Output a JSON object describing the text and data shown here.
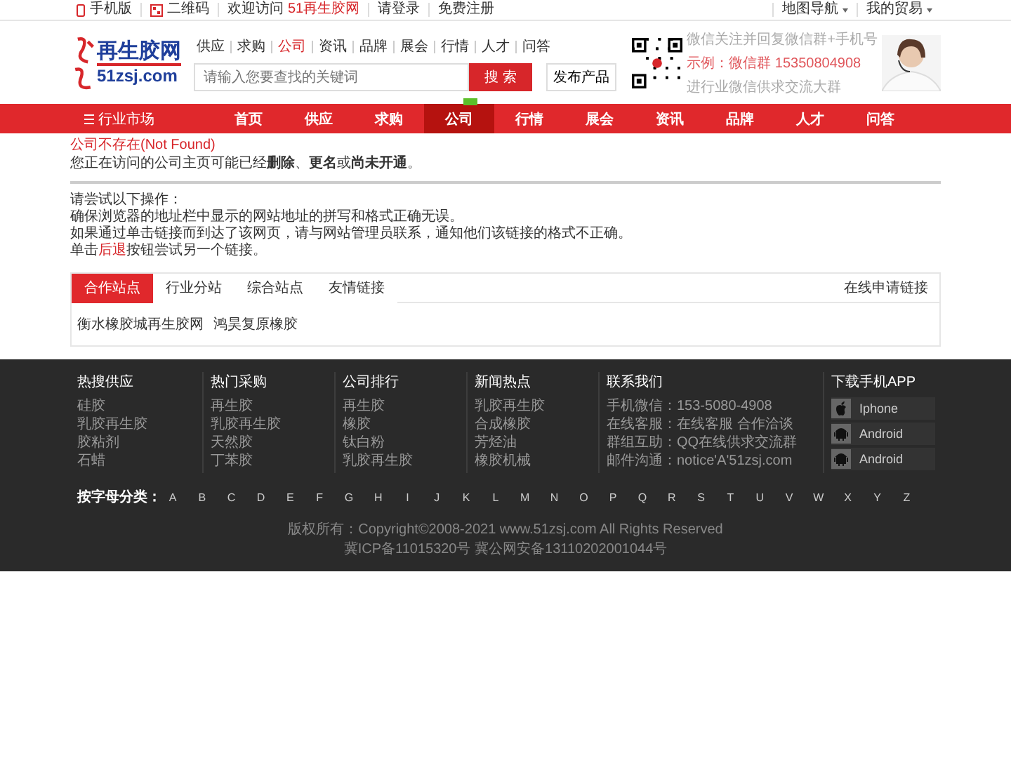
{
  "top_bar": {
    "left": [
      {
        "kind": "phone",
        "text": "手机版"
      },
      {
        "kind": "qr",
        "text": "二维码"
      },
      {
        "kind": "welcome",
        "text": "欢迎访问",
        "link": "51再生胶网"
      },
      {
        "kind": "plain",
        "text": "请登录"
      },
      {
        "kind": "plain",
        "text": "免费注册"
      }
    ],
    "right": [
      "地图导航",
      "我的贸易"
    ]
  },
  "header": {
    "logo": {
      "name": "再生胶网",
      "domain": "51zsj.com"
    },
    "channels": [
      {
        "label": "供应",
        "selected": false
      },
      {
        "label": "求购",
        "selected": false
      },
      {
        "label": "公司",
        "selected": true
      },
      {
        "label": "资讯",
        "selected": false
      },
      {
        "label": "品牌",
        "selected": false
      },
      {
        "label": "展会",
        "selected": false
      },
      {
        "label": "行情",
        "selected": false
      },
      {
        "label": "人才",
        "selected": false
      },
      {
        "label": "问答",
        "selected": false
      }
    ],
    "search": {
      "placeholder": "请输入您要查找的关键词",
      "button": "搜 索"
    },
    "publish_button": "发布产品",
    "promo": [
      "微信关注并回复微信群+手机号",
      "示例：微信群 15350804908",
      "进行业微信供求交流大群"
    ]
  },
  "main_nav": {
    "category": "行业市场",
    "items": [
      {
        "label": "首页",
        "selected": false,
        "badge": false
      },
      {
        "label": "供应",
        "selected": false,
        "badge": false
      },
      {
        "label": "求购",
        "selected": false,
        "badge": false
      },
      {
        "label": "公司",
        "selected": true,
        "badge": true
      },
      {
        "label": "行情",
        "selected": false,
        "badge": false
      },
      {
        "label": "展会",
        "selected": false,
        "badge": false
      },
      {
        "label": "资讯",
        "selected": false,
        "badge": false
      },
      {
        "label": "品牌",
        "selected": false,
        "badge": false
      },
      {
        "label": "人才",
        "selected": false,
        "badge": false
      },
      {
        "label": "问答",
        "selected": false,
        "badge": false
      }
    ]
  },
  "notice": {
    "title": "公司不存在(Not Found)",
    "message": "您正在访问的公司主页可能已经**删除**、**更名**或**尚未开通**。",
    "prompt": "请尝试以下操作：",
    "steps": [
      {
        "text": "确保浏览器的地址栏中显示的网站地址的拼写和格式正确无误。"
      },
      {
        "text": "如果通过单击链接而到达了该网页，请与网站管理员联系，通知他们该链接的格式不正确。"
      },
      {
        "text": "单击",
        "link": "后退",
        "after": "按钮尝试另一个链接。"
      }
    ]
  },
  "links_box": {
    "tabs": [
      {
        "label": "合作站点",
        "selected": true
      },
      {
        "label": "行业分站",
        "selected": false
      },
      {
        "label": "综合站点",
        "selected": false
      },
      {
        "label": "友情链接",
        "selected": false
      }
    ],
    "apply": "在线申请链接",
    "links": [
      "衡水橡胶城再生胶网",
      "鸿昊复原橡胶"
    ]
  },
  "footer": {
    "columns": [
      {
        "title": "热搜供应",
        "items": [
          "硅胶",
          "乳胶再生胶",
          "胶粘剂",
          "石蜡"
        ]
      },
      {
        "title": "热门采购",
        "items": [
          "再生胶",
          "乳胶再生胶",
          "天然胶",
          "丁苯胶"
        ]
      },
      {
        "title": "公司排行",
        "items": [
          "再生胶",
          "橡胶",
          "钛白粉",
          "乳胶再生胶"
        ]
      },
      {
        "title": "新闻热点",
        "items": [
          "乳胶再生胶",
          "合成橡胶",
          "芳烃油",
          "橡胶机械"
        ]
      },
      {
        "title": "联系我们",
        "items": [
          "手机微信：153-5080-4908",
          "在线客服：在线客服 合作洽谈",
          "群组互助：QQ在线供求交流群",
          "邮件沟通：notice'A'51zsj.com"
        ]
      }
    ],
    "app": {
      "title": "下载手机APP",
      "items": [
        {
          "kind": "apple",
          "label": "Iphone"
        },
        {
          "kind": "android",
          "label": "Android"
        },
        {
          "kind": "android",
          "label": "Android"
        }
      ]
    },
    "letters_label": "按字母分类：",
    "letters": [
      "A",
      "B",
      "C",
      "D",
      "E",
      "F",
      "G",
      "H",
      "I",
      "J",
      "K",
      "L",
      "M",
      "N",
      "O",
      "P",
      "Q",
      "R",
      "S",
      "T",
      "U",
      "V",
      "W",
      "X",
      "Y",
      "Z"
    ],
    "copyright": "版权所有：Copyright©2008-2021 www.51zsj.com All Rights Reserved",
    "icp": "冀ICP备11015320号  冀公网安备13110202001044号"
  }
}
